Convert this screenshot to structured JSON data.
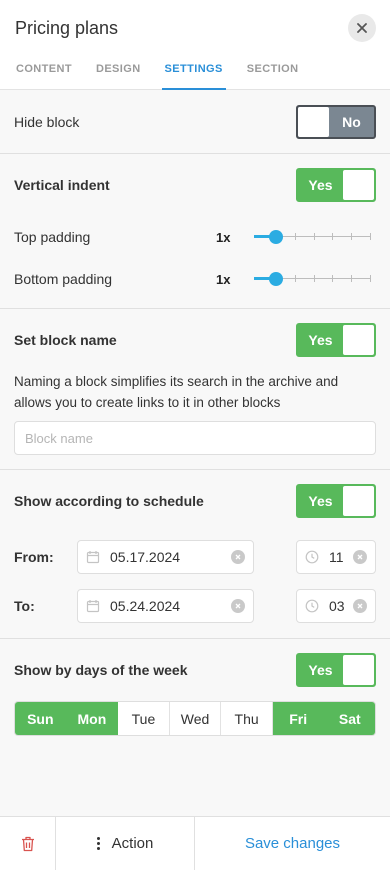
{
  "header": {
    "title": "Pricing plans"
  },
  "tabs": [
    {
      "label": "CONTENT"
    },
    {
      "label": "DESIGN"
    },
    {
      "label": "SETTINGS"
    },
    {
      "label": "SECTION"
    }
  ],
  "hide_block": {
    "label": "Hide block",
    "toggle_text": "No",
    "value": false
  },
  "vertical_indent": {
    "label": "Vertical indent",
    "toggle_text": "Yes",
    "value": true,
    "top": {
      "label": "Top padding",
      "multiplier": "1x",
      "level": 1,
      "steps": 6
    },
    "bottom": {
      "label": "Bottom padding",
      "multiplier": "1x",
      "level": 1,
      "steps": 6
    }
  },
  "block_name": {
    "label": "Set block name",
    "toggle_text": "Yes",
    "value": true,
    "description": "Naming a block simplifies its search in the archive and allows you to create links to it in other blocks",
    "placeholder": "Block name",
    "value_text": ""
  },
  "schedule": {
    "label": "Show according to schedule",
    "toggle_text": "Yes",
    "value": true,
    "from": {
      "label": "From:",
      "date": "05.17.2024",
      "time": "11"
    },
    "to": {
      "label": "To:",
      "date": "05.24.2024",
      "time": "03"
    }
  },
  "weekdays": {
    "label": "Show by days of the week",
    "toggle_text": "Yes",
    "value": true,
    "days": [
      {
        "label": "Sun",
        "active": true
      },
      {
        "label": "Mon",
        "active": true
      },
      {
        "label": "Tue",
        "active": false
      },
      {
        "label": "Wed",
        "active": false
      },
      {
        "label": "Thu",
        "active": false
      },
      {
        "label": "Fri",
        "active": true
      },
      {
        "label": "Sat",
        "active": true
      }
    ]
  },
  "footer": {
    "action_label": "Action",
    "save_label": "Save changes"
  },
  "colors": {
    "accent": "#2a8fd8",
    "green": "#58b95b",
    "slider": "#2bace2",
    "toggle_off": "#7b8792",
    "danger": "#d9534f"
  },
  "icons": {
    "close": "close-icon",
    "calendar": "calendar-icon",
    "clock": "clock-icon",
    "clear": "clear-icon",
    "trash": "trash-icon",
    "more": "more-vertical-icon"
  }
}
